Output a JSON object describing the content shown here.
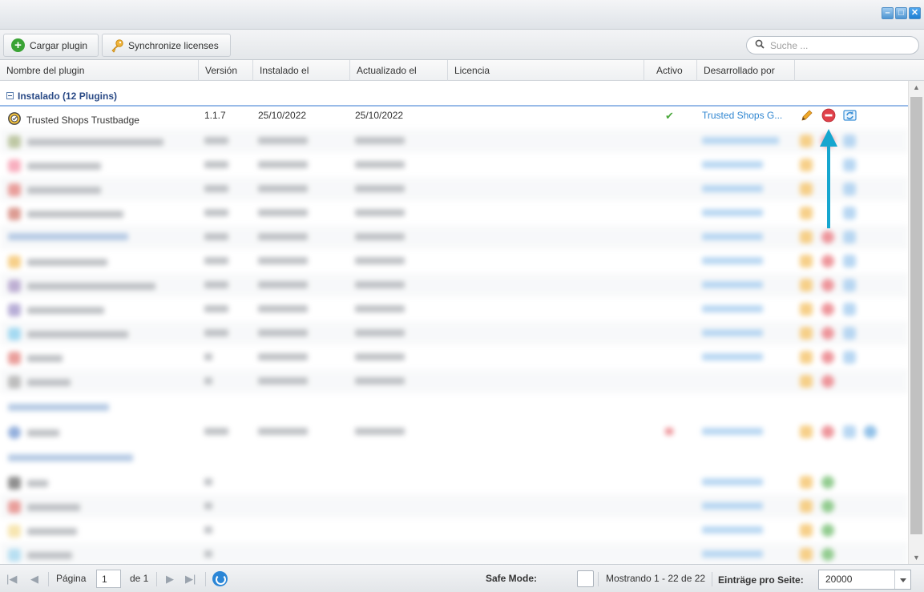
{
  "toolbar": {
    "upload_label": "Cargar plugin",
    "sync_label": "Synchronize licenses",
    "search_placeholder": "Suche ..."
  },
  "columns": {
    "name": "Nombre del plugin",
    "version": "Versión",
    "installed": "Instalado el",
    "updated": "Actualizado el",
    "license": "Licencia",
    "active": "Activo",
    "developer": "Desarrollado por"
  },
  "group": {
    "title": "Instalado (12 Plugins)"
  },
  "plugin": {
    "name": "Trusted Shops Trustbadge",
    "version": "1.1.7",
    "installed": "25/10/2022",
    "updated": "25/10/2022",
    "active_mark": "✔",
    "developer": "Trusted Shops G..."
  },
  "footer": {
    "page_label": "Página",
    "page_value": "1",
    "of_label": "de 1",
    "safe_mode_label": "Safe Mode:",
    "showing_label": "Mostrando 1 - 22 de 22",
    "per_page_label": "Einträge pro Seite:",
    "per_page_value": "20000"
  },
  "colors": {
    "accent": "#2f86d1",
    "group_title": "#2a4a86",
    "active_check": "#4ca83d",
    "annotation_arrow": "#16a6cf"
  }
}
